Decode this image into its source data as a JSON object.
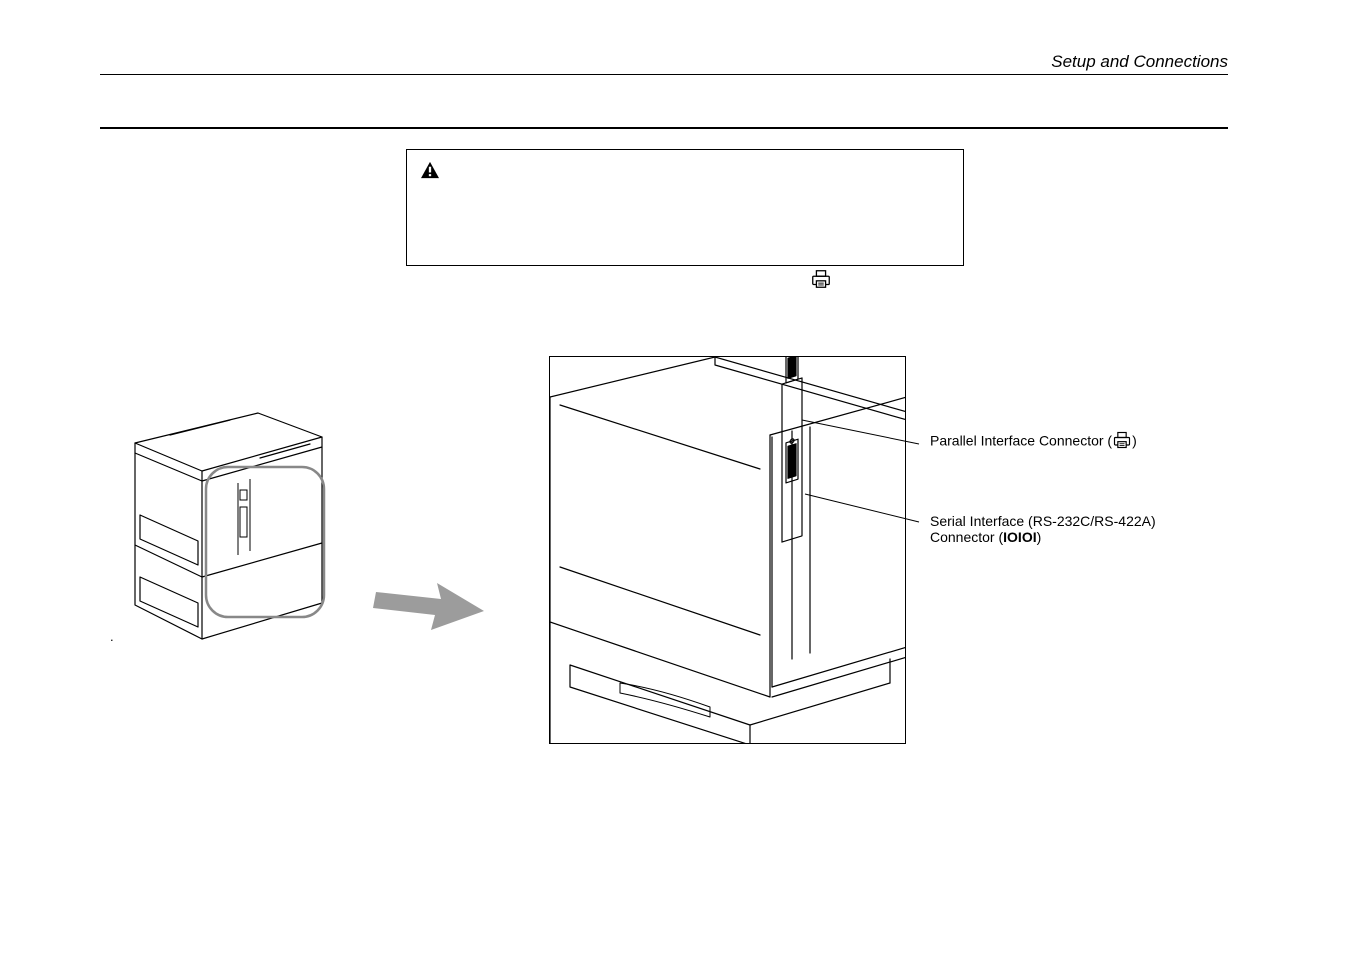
{
  "header": {
    "title": "Setup and Connections"
  },
  "overview_dot": ".",
  "labels": {
    "parallel_prefix": "Parallel Interface Connector (",
    "parallel_suffix": ")",
    "serial_line1": "Serial Interface (RS-232C/RS-422A)",
    "serial_line2_prefix": "Connector (",
    "serial_bold": "IOIOI",
    "serial_line2_suffix": ")"
  }
}
